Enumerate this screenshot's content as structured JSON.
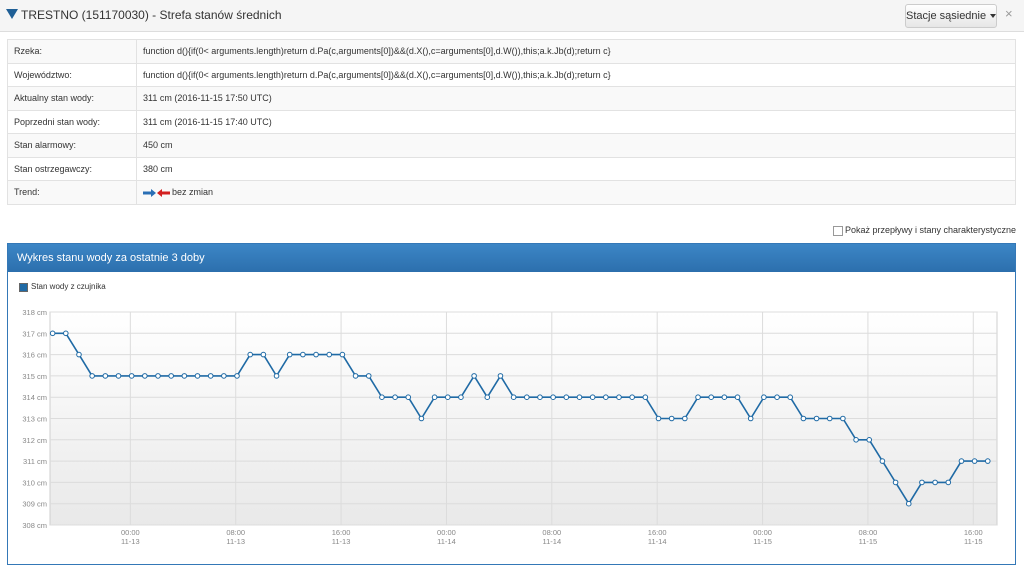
{
  "header": {
    "title": "TRESTNO (151170030) - Strefa stanów średnich",
    "neighbors_label": "Stacje sąsiednie",
    "close_label": "×"
  },
  "info": [
    {
      "label": "Rzeka:",
      "value": "function d(){if(0< arguments.length)return d.Pa(c,arguments[0])&&(d.X(),c=arguments[0],d.W()),this;a.k.Jb(d);return c}"
    },
    {
      "label": "Województwo:",
      "value": "function d(){if(0< arguments.length)return d.Pa(c,arguments[0])&&(d.X(),c=arguments[0],d.W()),this;a.k.Jb(d);return c}"
    },
    {
      "label": "Aktualny stan wody:",
      "value": "311 cm (2016-11-15 17:50 UTC)"
    },
    {
      "label": "Poprzedni stan wody:",
      "value": "311 cm (2016-11-15 17:40 UTC)"
    },
    {
      "label": "Stan alarmowy:",
      "value": "450 cm"
    },
    {
      "label": "Stan ostrzegawczy:",
      "value": "380 cm"
    },
    {
      "label": "Trend:",
      "value": "bez zmian"
    }
  ],
  "show_flows_label": "Pokaż przepływy i stany charakterystyczne",
  "panel_title": "Wykres stanu wody za ostatnie 3 doby",
  "colors": {
    "series": "#1f6aa5",
    "panel": "#2c6fad",
    "arrow_right": "#2a6fb5",
    "arrow_left": "#d32020"
  },
  "chart_data": {
    "type": "line",
    "legend": "Stan wody z czujnika",
    "y_ticks": [
      "308 cm",
      "309 cm",
      "310 cm",
      "311 cm",
      "312 cm",
      "313 cm",
      "314 cm",
      "315 cm",
      "316 cm",
      "317 cm",
      "318 cm"
    ],
    "ylim": [
      308,
      318
    ],
    "grid": true,
    "x_ticks": [
      {
        "time": "00:00",
        "date": "11-13",
        "hour": 0
      },
      {
        "time": "08:00",
        "date": "11-13",
        "hour": 8
      },
      {
        "time": "16:00",
        "date": "11-13",
        "hour": 16
      },
      {
        "time": "00:00",
        "date": "11-14",
        "hour": 24
      },
      {
        "time": "08:00",
        "date": "11-14",
        "hour": 32
      },
      {
        "time": "16:00",
        "date": "11-14",
        "hour": 40
      },
      {
        "time": "00:00",
        "date": "11-15",
        "hour": 48
      },
      {
        "time": "08:00",
        "date": "11-15",
        "hour": 56
      },
      {
        "time": "16:00",
        "date": "11-15",
        "hour": 64
      }
    ],
    "xlim_hours": [
      -6.1,
      65.8
    ],
    "series": [
      {
        "name": "Stan wody z czujnika",
        "x_hours": [
          -5.9,
          -4.9,
          -3.9,
          -2.9,
          -1.9,
          -0.9,
          0.1,
          1.1,
          2.1,
          3.1,
          4.1,
          5.1,
          6.1,
          7.1,
          8.1,
          9.1,
          10.1,
          11.1,
          12.1,
          13.1,
          14.1,
          15.1,
          16.1,
          17.1,
          18.1,
          19.1,
          20.1,
          21.1,
          22.1,
          23.1,
          24.1,
          25.1,
          26.1,
          27.1,
          28.1,
          29.1,
          30.1,
          31.1,
          32.1,
          33.1,
          34.1,
          35.1,
          36.1,
          37.1,
          38.1,
          39.1,
          40.1,
          41.1,
          42.1,
          43.1,
          44.1,
          45.1,
          46.1,
          47.1,
          48.1,
          49.1,
          50.1,
          51.1,
          52.1,
          53.1,
          54.1,
          55.1,
          56.1,
          57.1,
          58.1,
          59.1,
          60.1,
          61.1,
          62.1,
          63.1,
          64.1,
          65.1
        ],
        "values": [
          317,
          317,
          316,
          315,
          315,
          315,
          315,
          315,
          315,
          315,
          315,
          315,
          315,
          315,
          315,
          316,
          316,
          315,
          316,
          316,
          316,
          316,
          316,
          315,
          315,
          314,
          314,
          314,
          313,
          314,
          314,
          314,
          315,
          314,
          315,
          314,
          314,
          314,
          314,
          314,
          314,
          314,
          314,
          314,
          314,
          314,
          313,
          313,
          313,
          314,
          314,
          314,
          314,
          313,
          314,
          314,
          314,
          313,
          313,
          313,
          313,
          312,
          312,
          311,
          310,
          309,
          310,
          310,
          310,
          311,
          311,
          311
        ]
      }
    ]
  }
}
